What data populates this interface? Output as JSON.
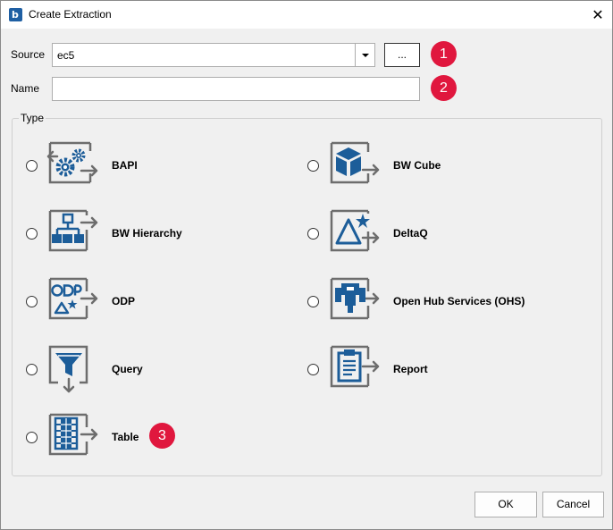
{
  "window": {
    "title": "Create Extraction",
    "app_icon_letter": "b",
    "close_glyph": "✕"
  },
  "form": {
    "source_label": "Source",
    "source_value": "ec5",
    "browse_label": "...",
    "name_label": "Name",
    "name_value": ""
  },
  "badges": [
    "1",
    "2",
    "3"
  ],
  "type_group": {
    "title": "Type",
    "options": [
      {
        "label": "BAPI",
        "icon": "bapi-gears-icon"
      },
      {
        "label": "BW Cube",
        "icon": "bw-cube-icon"
      },
      {
        "label": "BW Hierarchy",
        "icon": "bw-hierarchy-icon"
      },
      {
        "label": "DeltaQ",
        "icon": "deltaq-icon"
      },
      {
        "label": "ODP",
        "icon": "odp-icon"
      },
      {
        "label": "Open Hub Services (OHS)",
        "icon": "ohs-icon"
      },
      {
        "label": "Query",
        "icon": "query-filter-icon"
      },
      {
        "label": "Report",
        "icon": "report-clipboard-icon"
      },
      {
        "label": "Table",
        "icon": "table-icon"
      }
    ]
  },
  "footer": {
    "ok_label": "OK",
    "cancel_label": "Cancel"
  },
  "colors": {
    "icon_blue": "#1c5d99",
    "icon_gray": "#6d6d6d",
    "badge_red": "#e0173e"
  }
}
